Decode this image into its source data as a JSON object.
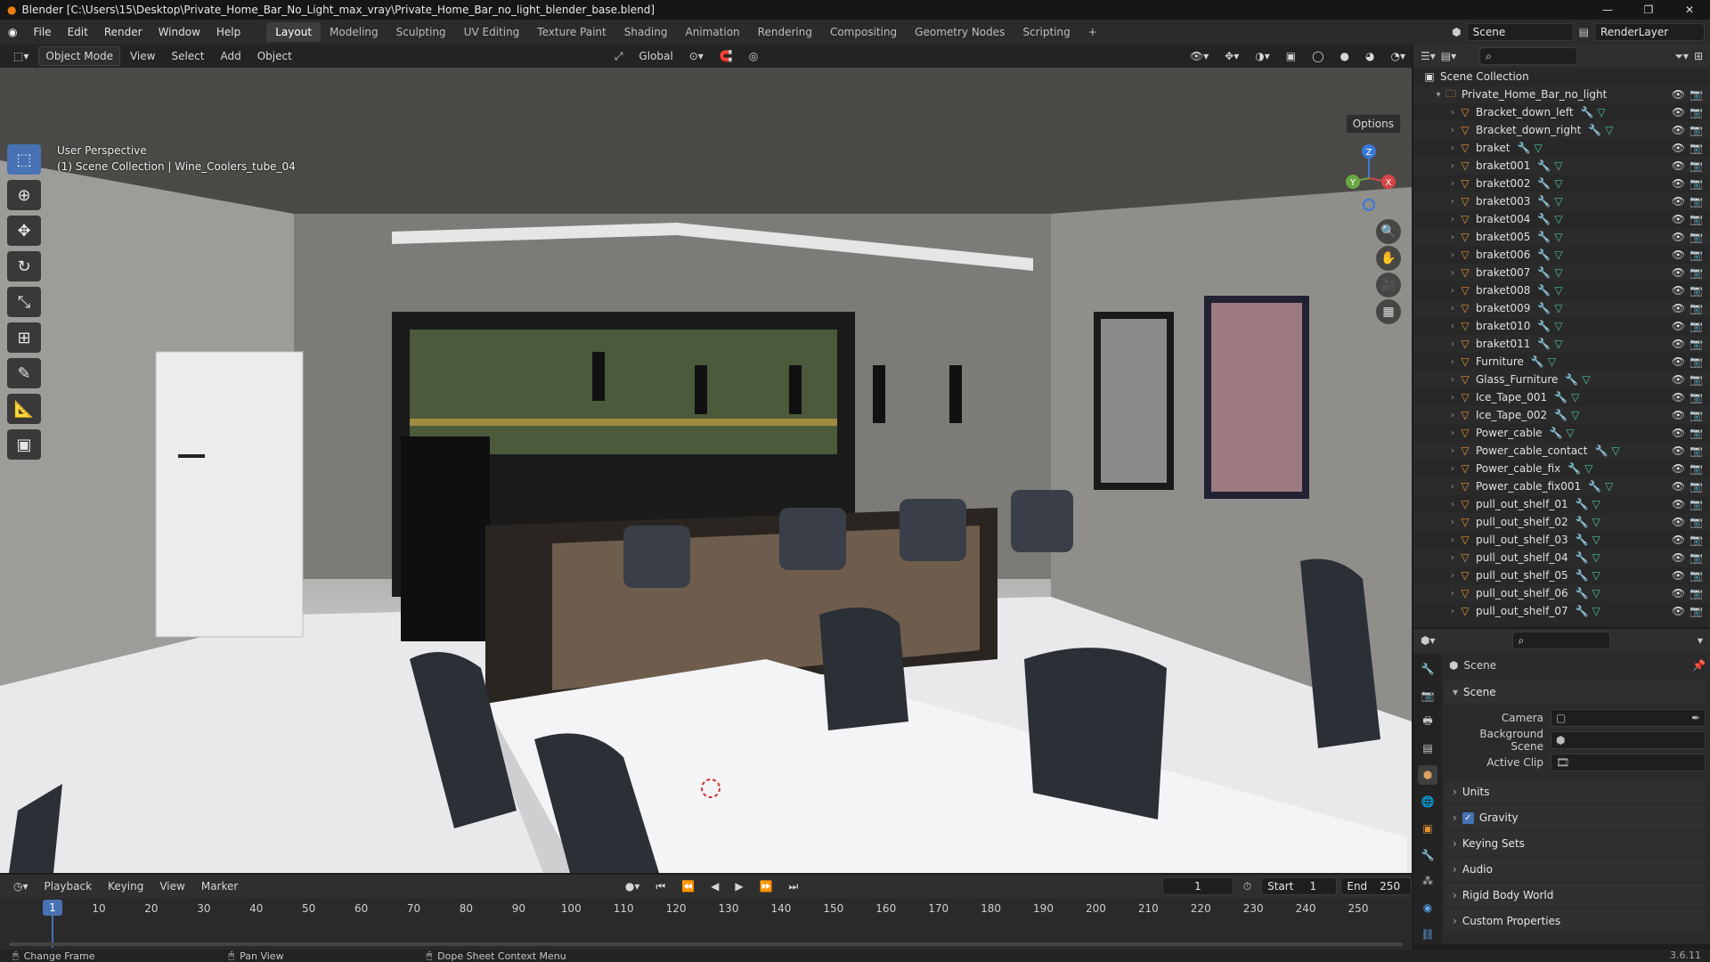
{
  "window": {
    "title": "Blender [C:\\Users\\15\\Desktop\\Private_Home_Bar_No_Light_max_vray\\Private_Home_Bar_no_light_blender_base.blend]"
  },
  "menu": {
    "items": [
      "File",
      "Edit",
      "Render",
      "Window",
      "Help"
    ],
    "workspaces": [
      "Layout",
      "Modeling",
      "Sculpting",
      "UV Editing",
      "Texture Paint",
      "Shading",
      "Animation",
      "Rendering",
      "Compositing",
      "Geometry Nodes",
      "Scripting"
    ],
    "active_workspace": "Layout",
    "add_tab": "+",
    "scene": "Scene",
    "view_layer": "RenderLayer"
  },
  "viewport": {
    "mode": "Object Mode",
    "menus": [
      "View",
      "Select",
      "Add",
      "Object"
    ],
    "orientation": "Global",
    "options": "Options",
    "info_line1": "User Perspective",
    "info_line2": "(1) Scene Collection | Wine_Coolers_tube_04",
    "gizmo_axes": [
      "Z",
      "Y",
      "X"
    ]
  },
  "outliner": {
    "root": "Scene Collection",
    "collection": "Private_Home_Bar_no_light",
    "objects": [
      "Bracket_down_left",
      "Bracket_down_right",
      "braket",
      "braket001",
      "braket002",
      "braket003",
      "braket004",
      "braket005",
      "braket006",
      "braket007",
      "braket008",
      "braket009",
      "braket010",
      "braket011",
      "Furniture",
      "Glass_Furniture",
      "Ice_Tape_001",
      "Ice_Tape_002",
      "Power_cable",
      "Power_cable_contact",
      "Power_cable_fix",
      "Power_cable_fix001",
      "pull_out_shelf_01",
      "pull_out_shelf_02",
      "pull_out_shelf_03",
      "pull_out_shelf_04",
      "pull_out_shelf_05",
      "pull_out_shelf_06",
      "pull_out_shelf_07"
    ]
  },
  "properties": {
    "context": "Scene",
    "panel": "Scene",
    "camera_label": "Camera",
    "background_scene_label": "Background Scene",
    "active_clip_label": "Active Clip",
    "collapsed_panels": [
      "Units",
      "Gravity",
      "Keying Sets",
      "Audio",
      "Rigid Body World",
      "Custom Properties"
    ],
    "gravity_checked": true
  },
  "timeline": {
    "menus": [
      "Playback",
      "Keying",
      "View",
      "Marker"
    ],
    "current_frame": "1",
    "start_label": "Start",
    "start": "1",
    "end_label": "End",
    "end": "250",
    "ruler_ticks": [
      "1",
      "10",
      "20",
      "30",
      "40",
      "50",
      "60",
      "70",
      "80",
      "90",
      "100",
      "110",
      "120",
      "130",
      "140",
      "150",
      "160",
      "170",
      "180",
      "190",
      "200",
      "210",
      "220",
      "230",
      "240",
      "250"
    ]
  },
  "statusbar": {
    "items": [
      "Change Frame",
      "Pan View",
      "Dope Sheet Context Menu"
    ],
    "version": "3.6.11"
  }
}
